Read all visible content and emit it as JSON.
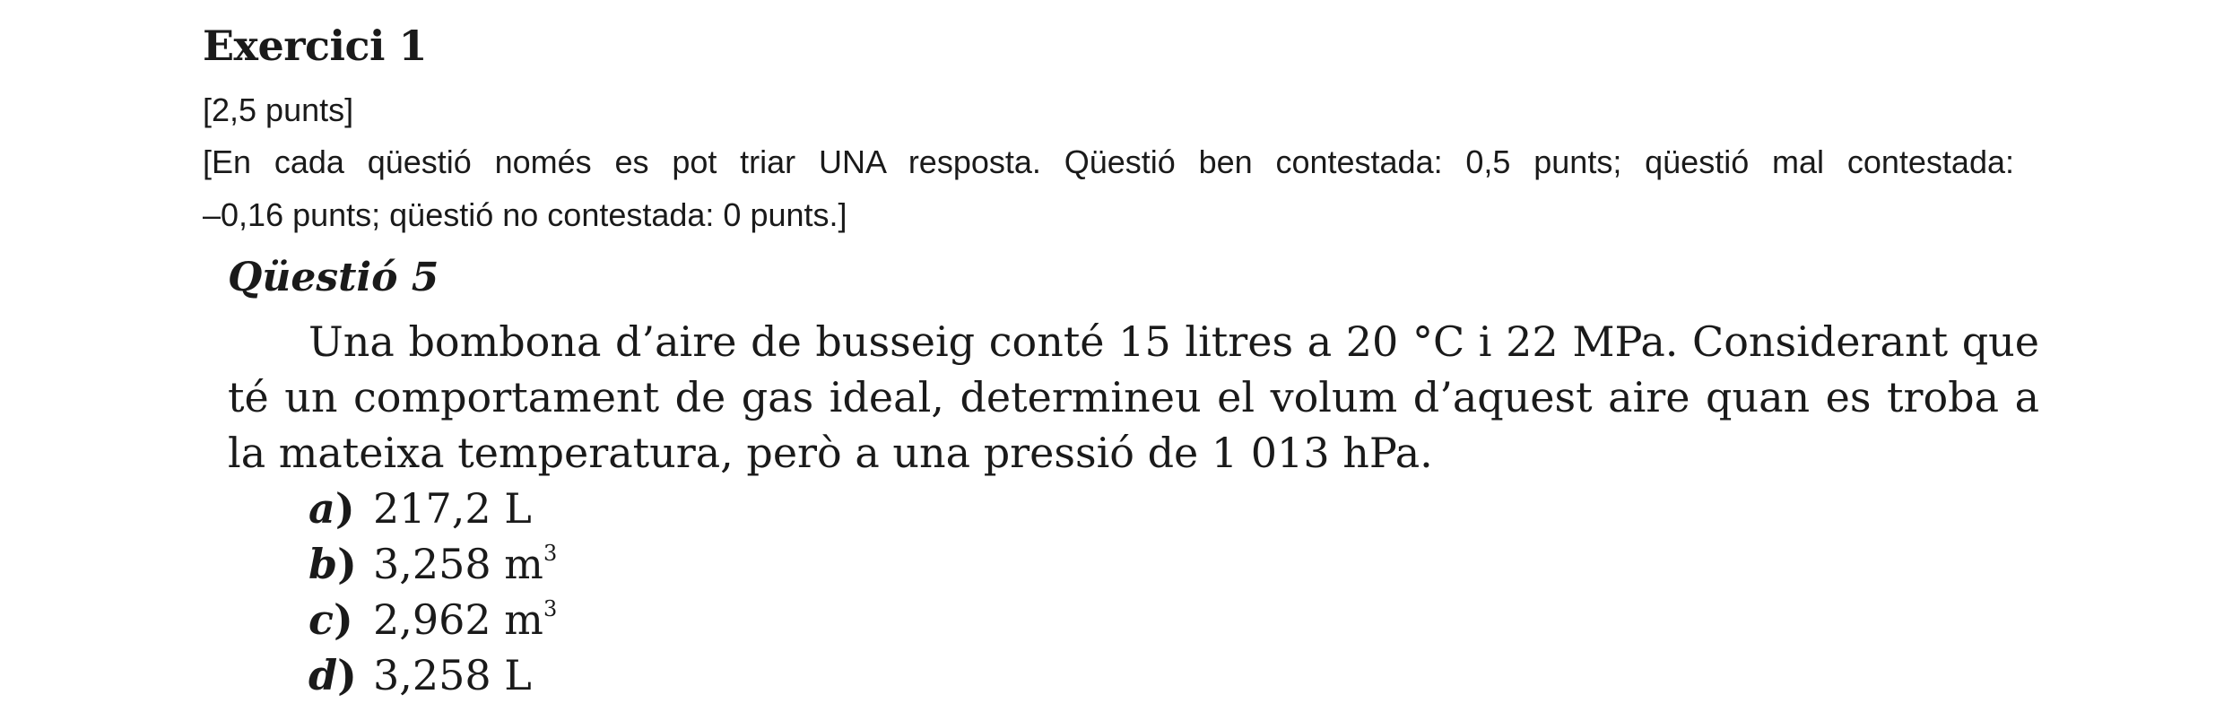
{
  "exercise": {
    "title": "Exercici 1",
    "points": "[2,5 punts]",
    "instructions_line1": "[En cada qüestió només es pot triar UNA resposta. Qüestió ben contestada: 0,5 punts; qüestió mal contestada:",
    "instructions_line2": "–0,16 punts; qüestió no contestada: 0 punts.]"
  },
  "question": {
    "title": "Qüestió 5",
    "text": "Una bombona d’aire de busseig conté 15 litres a 20 °C i 22 MPa. Considerant que té un comportament de gas ideal, determineu el volum d’aquest aire quan es troba a la mateixa temperatura, però a una pressió de 1 013 hPa.",
    "options": [
      {
        "letter": "a",
        "value": "217,2 L",
        "superscript": ""
      },
      {
        "letter": "b",
        "value": "3,258 m",
        "superscript": "3"
      },
      {
        "letter": "c",
        "value": "2,962 m",
        "superscript": "3"
      },
      {
        "letter": "d",
        "value": "3,258 L",
        "superscript": ""
      }
    ]
  }
}
